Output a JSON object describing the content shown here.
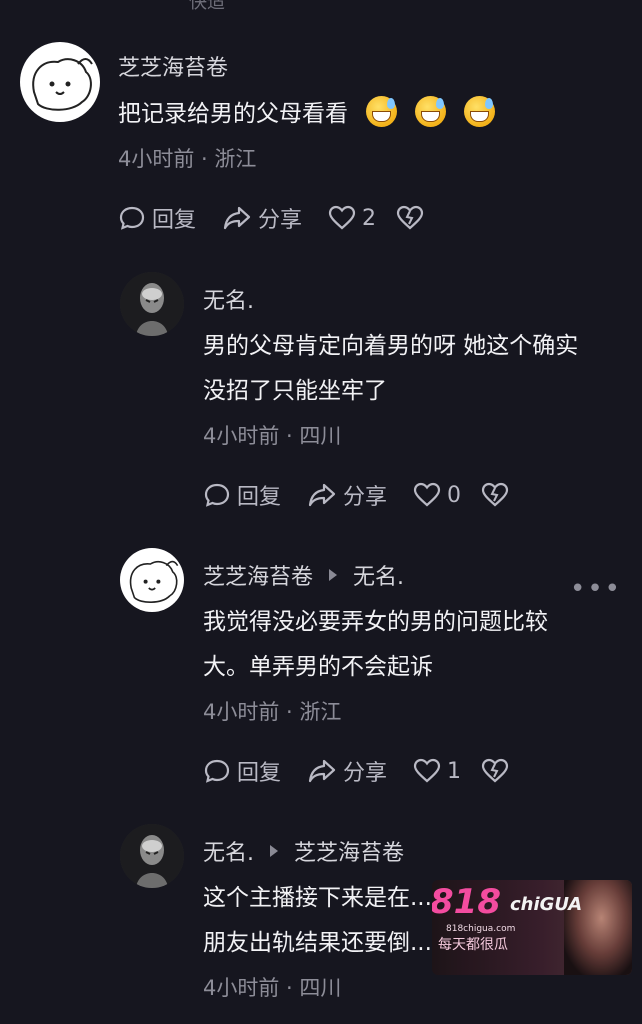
{
  "top_cut_text": "˙快适",
  "comments": [
    {
      "author": "芝芝海苔卷",
      "reply_to": "",
      "text_lines": [
        "把记录给男的父母看看"
      ],
      "meta": "4小时前 · 浙江",
      "reply_label": "回复",
      "share_label": "分享",
      "likes": "2"
    },
    {
      "author": "无名.",
      "reply_to": "",
      "text_lines": [
        "男的父母肯定向着男的呀 她这个确实",
        "没招了只能坐牢了"
      ],
      "meta": "4小时前 · 四川",
      "reply_label": "回复",
      "share_label": "分享",
      "likes": "0"
    },
    {
      "author": "芝芝海苔卷",
      "reply_to": "无名.",
      "text_lines": [
        "我觉得没必要弄女的男的问题比较",
        "大。单弄男的不会起诉"
      ],
      "meta": "4小时前 · 浙江",
      "reply_label": "回复",
      "share_label": "分享",
      "likes": "1"
    },
    {
      "author": "无名.",
      "reply_to": "芝芝海苔卷",
      "text_lines": [
        "这个主播接下来是在...",
        "朋友出轨结果还要倒..."
      ],
      "meta": "4小时前 · 四川",
      "reply_label": "",
      "share_label": "",
      "likes": ""
    }
  ],
  "watermark": {
    "logo": "818",
    "logo_suffix": "chiGUA",
    "domain": "818chigua.com",
    "tagline": "每天都很瓜"
  },
  "more_dots": "•••"
}
